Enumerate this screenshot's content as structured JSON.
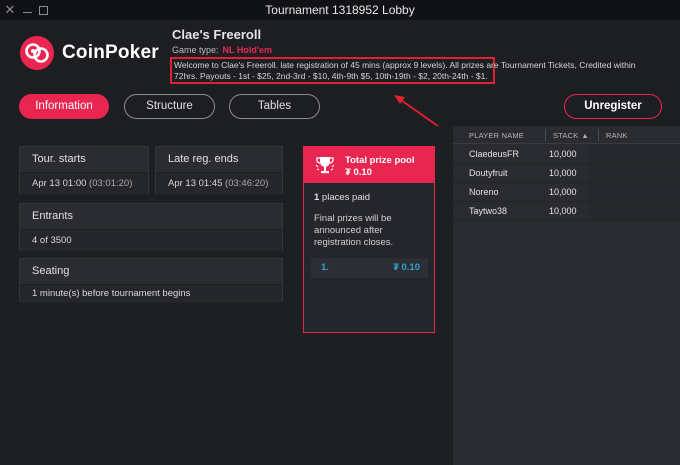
{
  "window": {
    "title": "Tournament 1318952 Lobby",
    "controls": [
      "close-icon",
      "minimize-icon",
      "maximize-icon"
    ]
  },
  "brand": {
    "name": "CoinPoker",
    "accent_color": "#e8264f"
  },
  "tournament": {
    "name": "Clae's Freeroll",
    "game_type_label": "Game type:",
    "game_type_value": "NL Hold'em",
    "welcome_text": "Welcome to Clae's Freeroll. late registration of 45 mins (approx 9 levels). All prizes are Tournament Tickets, Credited within 72hrs. Payouts - 1st - $25, 2nd-3rd - $10, 4th-9th $5, 10th-19th - $2, 20th-24th - $1."
  },
  "tabs": {
    "information": "Information",
    "structure": "Structure",
    "tables": "Tables",
    "active": "information"
  },
  "actions": {
    "unregister": "Unregister"
  },
  "info": {
    "tour_starts": {
      "label": "Tour. starts",
      "value": "Apr 13 01:00",
      "sub": "(03:01:20)"
    },
    "late_reg_ends": {
      "label": "Late reg. ends",
      "value": "Apr 13 01:45",
      "sub": "(03:46:20)"
    },
    "entrants": {
      "label": "Entrants",
      "value": "4 of 3500"
    },
    "seating": {
      "label": "Seating",
      "value": "1 minute(s) before tournament begins"
    }
  },
  "prize_pool": {
    "label": "Total prize pool",
    "amount": "₮ 0.10",
    "places_count": "1",
    "places_suffix": " places paid",
    "note": "Final prizes will be announced after registration closes.",
    "payouts": [
      {
        "position": "1.",
        "amount": "₮ 0.10"
      }
    ]
  },
  "players_table": {
    "columns": {
      "name": "PLAYER NAME",
      "stack": "STACK",
      "rank": "RANK"
    },
    "sort_icon": "chevron-up-icon",
    "rows": [
      {
        "name": "ClaedeusFR",
        "stack": "10,000",
        "rank": ""
      },
      {
        "name": "Doutyfruit",
        "stack": "10,000",
        "rank": ""
      },
      {
        "name": "Noreno",
        "stack": "10,000",
        "rank": ""
      },
      {
        "name": "Taytwo38",
        "stack": "10,000",
        "rank": ""
      }
    ]
  }
}
